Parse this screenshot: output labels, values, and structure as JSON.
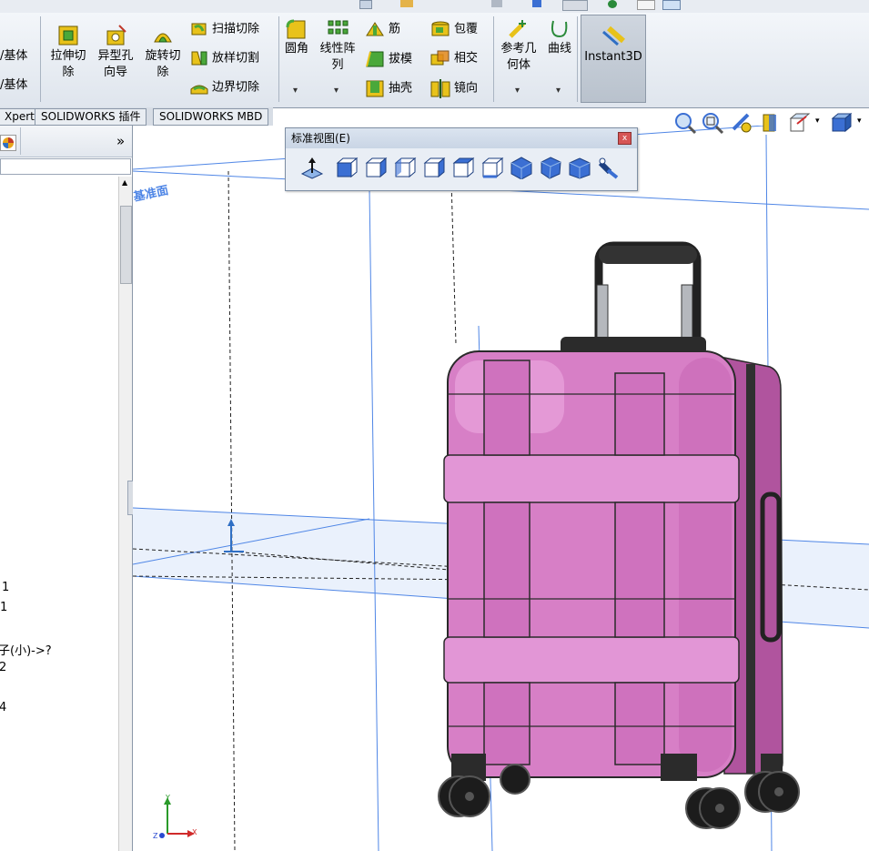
{
  "ribbon": {
    "left_partial_1": "/基体",
    "left_partial_2": "/基体",
    "extrude_cut": [
      "拉伸切",
      "除"
    ],
    "hole_wizard": [
      "异型孔",
      "向导"
    ],
    "revolve_cut": [
      "旋转切",
      "除"
    ],
    "sweep_cut": "扫描切除",
    "loft_cut": "放样切割",
    "boundary_cut": "边界切除",
    "fillet": "圆角",
    "linear_pattern": [
      "线性阵",
      "列"
    ],
    "rib": "筋",
    "draft": "拔模",
    "shell": "抽壳",
    "wrap": "包覆",
    "intersect": "相交",
    "mirror": "镜向",
    "reference_geometry": [
      "参考几",
      "何体"
    ],
    "curves": "曲线",
    "instant3d": "Instant3D",
    "dropdown_arrow": "▾"
  },
  "tabs": [
    "Xpert",
    "SOLIDWORKS 插件",
    "SOLIDWORKS MBD"
  ],
  "left_panel": {
    "expand_arrows": "»",
    "tree_items": [
      "1",
      "1",
      "子(小)->?",
      "2",
      "4"
    ]
  },
  "std_view_toolbar": {
    "title": "标准视图(E)",
    "close_glyph": "x"
  },
  "viewport": {
    "plane_label": "基准面",
    "triad_y": "Y",
    "triad_x": "X",
    "triad_z": "Z"
  },
  "colors": {
    "suitcase_body": "#d77fc6",
    "suitcase_highlight": "#f1b3e6",
    "plane_line": "#4f86e6",
    "ribbon_icon_yellow": "#e8c21a",
    "ribbon_icon_green": "#4aa83a"
  }
}
